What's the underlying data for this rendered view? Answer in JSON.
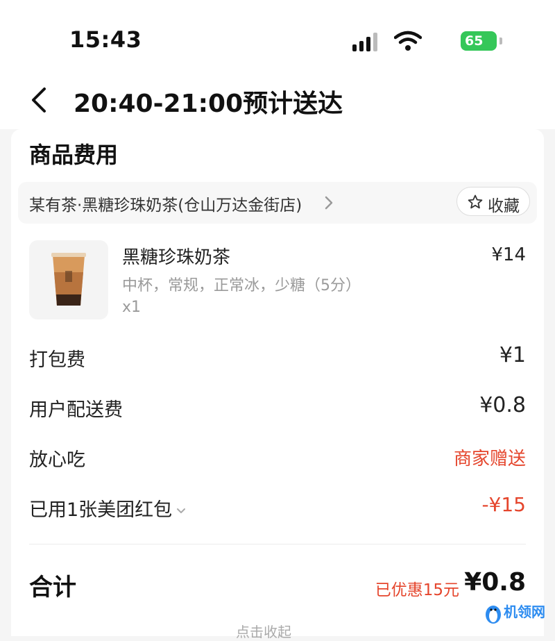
{
  "status_bar": {
    "time": "15:43",
    "battery": "65"
  },
  "nav": {
    "title": "20:40-21:00预计送达"
  },
  "section": {
    "title": "商品费用"
  },
  "shop": {
    "name": "某有茶·黑糖珍珠奶茶(仓山万达金街店)",
    "favorite_label": "收藏"
  },
  "product": {
    "name": "黑糖珍珠奶茶",
    "spec": "中杯，常规，正常冰，少糖（5分）",
    "quantity": "x1",
    "price": "¥14"
  },
  "fees": [
    {
      "label": "打包费",
      "value": "¥1"
    },
    {
      "label": "用户配送费",
      "value": "¥0.8"
    },
    {
      "label": "放心吃",
      "value": "商家赠送"
    },
    {
      "label": "已用1张美团红包",
      "value": "-¥15"
    }
  ],
  "total": {
    "label": "合计",
    "saved": "已优惠15元",
    "amount": "¥0.8"
  },
  "collapse_hint": "点击收起",
  "watermark": {
    "text": "机领网"
  },
  "colors": {
    "accent_red": "#e5452c",
    "battery_green": "#35c759",
    "text_primary": "#222222",
    "text_secondary": "#9a9a9a"
  }
}
